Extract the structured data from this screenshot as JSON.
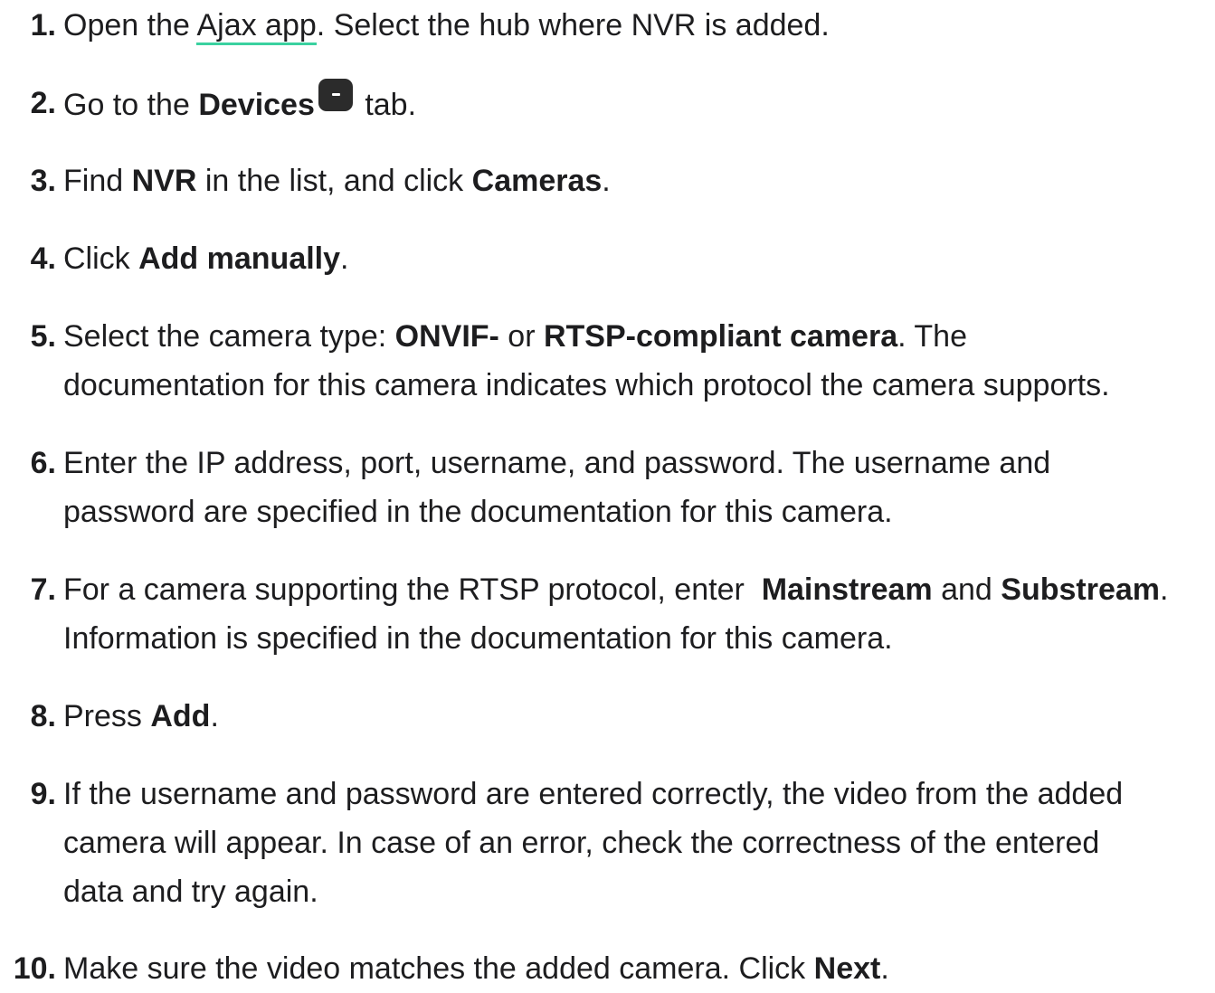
{
  "steps": [
    {
      "number": "1.",
      "parts": [
        "Open the ",
        "Ajax app",
        ". Select the hub where NVR is added."
      ]
    },
    {
      "number": "2.",
      "parts": [
        "Go to the ",
        "Devices",
        " tab."
      ],
      "icon": "devices-tab-icon"
    },
    {
      "number": "3.",
      "parts": [
        "Find ",
        "NVR",
        " in the list, and click ",
        "Cameras",
        "."
      ]
    },
    {
      "number": "4.",
      "parts": [
        "Click ",
        "Add manually",
        "."
      ]
    },
    {
      "number": "5.",
      "parts": [
        "Select the camera type: ",
        "ONVIF-",
        " or ",
        "RTSP-compliant camera",
        ". The",
        "documentation for this camera indicates which protocol the camera supports."
      ]
    },
    {
      "number": "6.",
      "parts": [
        "Enter the IP address, port, username, and password. The username and",
        "password are specified in the documentation for this camera."
      ]
    },
    {
      "number": "7.",
      "parts": [
        "For a camera supporting the RTSP protocol, enter  ",
        "Mainstream",
        " and ",
        "Substream",
        ".",
        "Information is specified in the documentation for this camera."
      ]
    },
    {
      "number": "8.",
      "parts": [
        "Press ",
        "Add",
        "."
      ]
    },
    {
      "number": "9.",
      "parts": [
        "If the username and password are entered correctly, the video from the added",
        "camera will appear. In case of an error, check the correctness of the entered",
        "data and try again."
      ]
    },
    {
      "number": "10.",
      "parts": [
        "Make sure the video matches the added camera. Click ",
        "Next",
        "."
      ]
    }
  ],
  "colors": {
    "text": "#1d1d1f",
    "link_underline": "#3ad1a0",
    "icon_bg": "#2b2b2b"
  }
}
